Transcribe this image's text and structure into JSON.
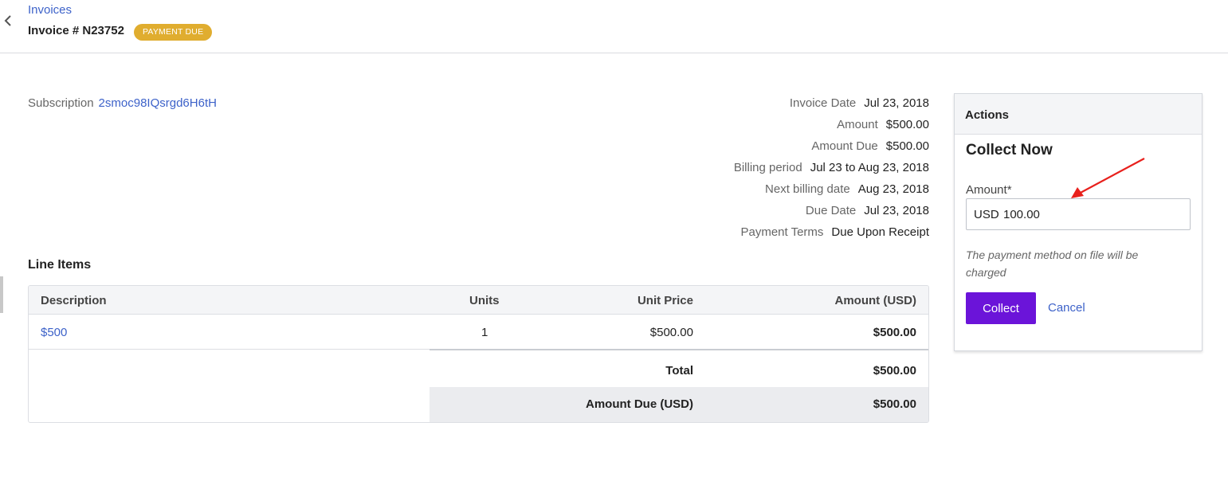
{
  "header": {
    "breadcrumb": "Invoices",
    "invoice_title": "Invoice # N23752",
    "status_badge": "PAYMENT DUE"
  },
  "subscription": {
    "label": "Subscription",
    "id": "2smoc98IQsrgd6H6tH"
  },
  "meta": [
    {
      "label": "Invoice Date",
      "value": "Jul 23, 2018"
    },
    {
      "label": "Amount",
      "value": "$500.00"
    },
    {
      "label": "Amount Due",
      "value": "$500.00"
    },
    {
      "label": "Billing period",
      "value": "Jul 23 to Aug 23, 2018"
    },
    {
      "label": "Next billing date",
      "value": "Aug 23, 2018"
    },
    {
      "label": "Due Date",
      "value": "Jul 23, 2018"
    },
    {
      "label": "Payment Terms",
      "value": "Due Upon Receipt"
    }
  ],
  "line_items": {
    "title": "Line Items",
    "columns": [
      "Description",
      "Units",
      "Unit Price",
      "Amount (USD)"
    ],
    "rows": [
      {
        "description": "$500",
        "units": "1",
        "unit_price": "$500.00",
        "amount": "$500.00"
      }
    ],
    "total_label": "Total",
    "total_value": "$500.00",
    "amount_due_label": "Amount Due (USD)",
    "amount_due_value": "$500.00"
  },
  "actions": {
    "panel_title": "Actions",
    "section_title": "Collect Now",
    "amount_label": "Amount*",
    "currency": "USD",
    "amount_value": "100.00",
    "note": "The payment method on file will be charged",
    "collect_button": "Collect",
    "cancel_link": "Cancel"
  },
  "icons": {
    "back": "chevron-left-icon",
    "annotation": "red-arrow-icon"
  },
  "colors": {
    "link": "#3d62c9",
    "badge": "#e0ad2f",
    "primary_button": "#6b14d9",
    "annotation_arrow": "#e8201c"
  }
}
